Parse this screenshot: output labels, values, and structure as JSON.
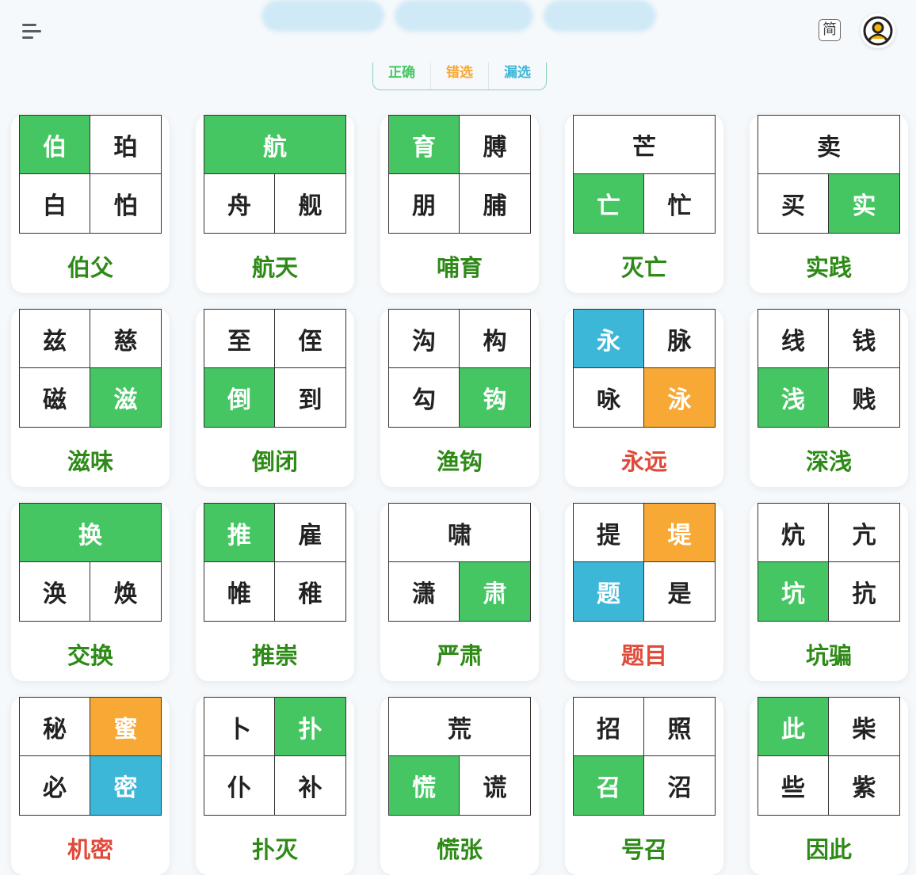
{
  "header": {
    "lang_toggle": "简",
    "menu_icon": "menu-icon",
    "avatar_icon": "user-avatar-icon"
  },
  "legend": [
    {
      "label": "正确",
      "color": "#45c663"
    },
    {
      "label": "错选",
      "color": "#f7a835"
    },
    {
      "label": "漏选",
      "color": "#3db7d8"
    }
  ],
  "colors": {
    "correct": "#45c663",
    "wrong": "#f7a835",
    "missed": "#3db7d8",
    "word_ok": "#2e8a17",
    "word_error": "#e04a3a"
  },
  "cards": [
    {
      "word": "伯父",
      "result": "correct",
      "cells": [
        {
          "ch": "伯",
          "state": "correct"
        },
        {
          "ch": "珀"
        },
        {
          "ch": "白"
        },
        {
          "ch": "怕"
        }
      ]
    },
    {
      "word": "航天",
      "result": "correct",
      "cells": [
        {
          "ch": "航",
          "state": "correct",
          "span": 2
        },
        {
          "ch": "舟"
        },
        {
          "ch": "舰"
        }
      ]
    },
    {
      "word": "哺育",
      "result": "correct",
      "cells": [
        {
          "ch": "育",
          "state": "correct"
        },
        {
          "ch": "膊"
        },
        {
          "ch": "朋"
        },
        {
          "ch": "脯"
        }
      ]
    },
    {
      "word": "灭亡",
      "result": "correct",
      "cells": [
        {
          "ch": "芒",
          "span": 2
        },
        {
          "ch": "亡",
          "state": "correct"
        },
        {
          "ch": "忙"
        }
      ]
    },
    {
      "word": "实践",
      "result": "correct",
      "cells": [
        {
          "ch": "卖",
          "span": 2
        },
        {
          "ch": "买"
        },
        {
          "ch": "实",
          "state": "correct"
        }
      ]
    },
    {
      "word": "滋味",
      "result": "correct",
      "cells": [
        {
          "ch": "兹"
        },
        {
          "ch": "慈"
        },
        {
          "ch": "磁"
        },
        {
          "ch": "滋",
          "state": "correct"
        }
      ]
    },
    {
      "word": "倒闭",
      "result": "correct",
      "cells": [
        {
          "ch": "至"
        },
        {
          "ch": "侄"
        },
        {
          "ch": "倒",
          "state": "correct"
        },
        {
          "ch": "到"
        }
      ]
    },
    {
      "word": "渔钩",
      "result": "correct",
      "cells": [
        {
          "ch": "沟"
        },
        {
          "ch": "构"
        },
        {
          "ch": "勾"
        },
        {
          "ch": "钩",
          "state": "correct"
        }
      ]
    },
    {
      "word": "永远",
      "result": "error",
      "cells": [
        {
          "ch": "永",
          "state": "missed"
        },
        {
          "ch": "脉"
        },
        {
          "ch": "咏"
        },
        {
          "ch": "泳",
          "state": "wrong"
        }
      ]
    },
    {
      "word": "深浅",
      "result": "correct",
      "cells": [
        {
          "ch": "线"
        },
        {
          "ch": "钱"
        },
        {
          "ch": "浅",
          "state": "correct"
        },
        {
          "ch": "贱"
        }
      ]
    },
    {
      "word": "交换",
      "result": "correct",
      "cells": [
        {
          "ch": "换",
          "state": "correct",
          "span": 2
        },
        {
          "ch": "涣"
        },
        {
          "ch": "焕"
        }
      ]
    },
    {
      "word": "推崇",
      "result": "correct",
      "cells": [
        {
          "ch": "推",
          "state": "correct"
        },
        {
          "ch": "雇"
        },
        {
          "ch": "帷"
        },
        {
          "ch": "稚"
        }
      ]
    },
    {
      "word": "严肃",
      "result": "correct",
      "cells": [
        {
          "ch": "啸",
          "span": 2
        },
        {
          "ch": "潇"
        },
        {
          "ch": "肃",
          "state": "correct"
        }
      ]
    },
    {
      "word": "题目",
      "result": "error",
      "cells": [
        {
          "ch": "提"
        },
        {
          "ch": "堤",
          "state": "wrong"
        },
        {
          "ch": "题",
          "state": "missed"
        },
        {
          "ch": "是"
        }
      ]
    },
    {
      "word": "坑骗",
      "result": "correct",
      "cells": [
        {
          "ch": "炕"
        },
        {
          "ch": "亢"
        },
        {
          "ch": "坑",
          "state": "correct"
        },
        {
          "ch": "抗"
        }
      ]
    },
    {
      "word": "机密",
      "result": "error",
      "cells": [
        {
          "ch": "秘"
        },
        {
          "ch": "蜜",
          "state": "wrong"
        },
        {
          "ch": "必"
        },
        {
          "ch": "密",
          "state": "missed"
        }
      ]
    },
    {
      "word": "扑灭",
      "result": "correct",
      "cells": [
        {
          "ch": "卜"
        },
        {
          "ch": "扑",
          "state": "correct"
        },
        {
          "ch": "仆"
        },
        {
          "ch": "补"
        }
      ]
    },
    {
      "word": "慌张",
      "result": "correct",
      "cells": [
        {
          "ch": "荒",
          "span": 2
        },
        {
          "ch": "慌",
          "state": "correct"
        },
        {
          "ch": "谎"
        }
      ]
    },
    {
      "word": "号召",
      "result": "correct",
      "cells": [
        {
          "ch": "招"
        },
        {
          "ch": "照"
        },
        {
          "ch": "召",
          "state": "correct"
        },
        {
          "ch": "沼"
        }
      ]
    },
    {
      "word": "因此",
      "result": "correct",
      "cells": [
        {
          "ch": "此",
          "state": "correct"
        },
        {
          "ch": "柴"
        },
        {
          "ch": "些"
        },
        {
          "ch": "紫"
        }
      ]
    }
  ]
}
